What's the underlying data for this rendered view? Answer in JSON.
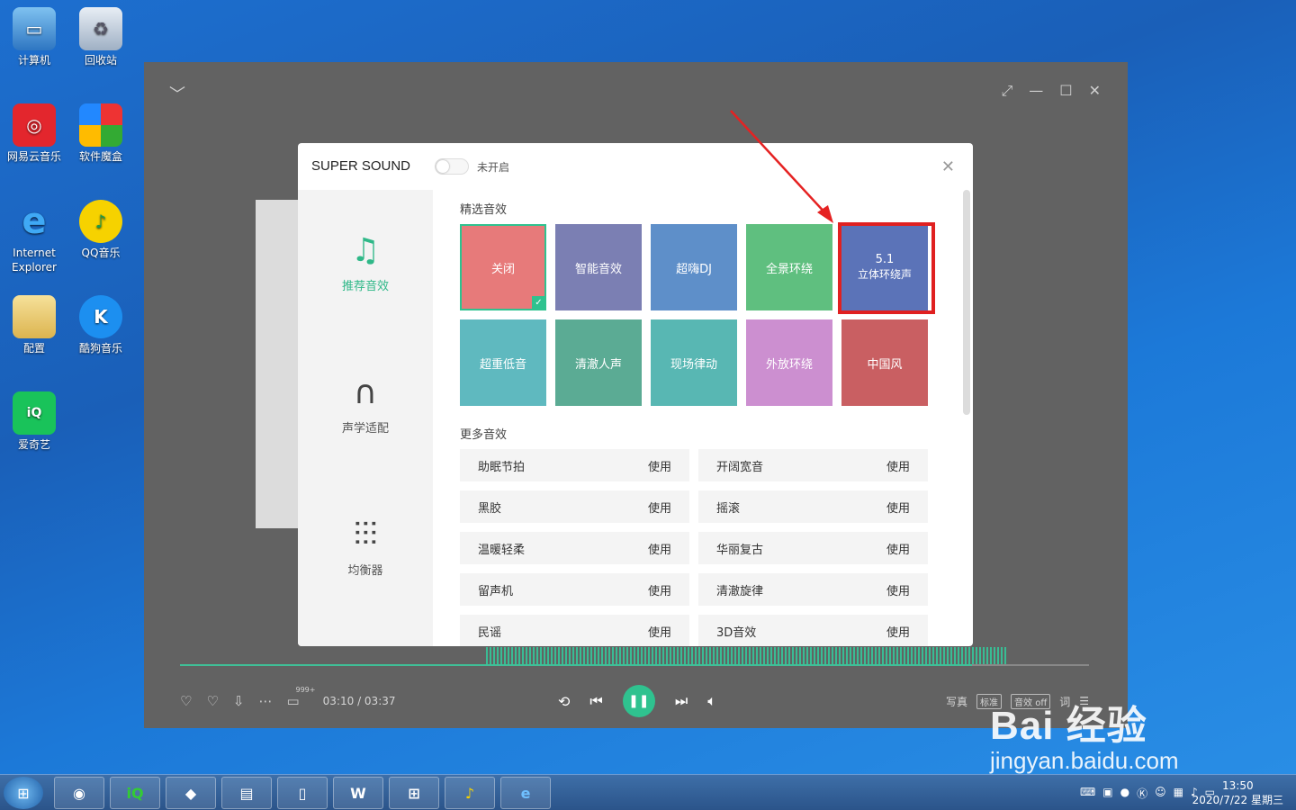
{
  "desktop": {
    "icons": [
      {
        "label": "计算机"
      },
      {
        "label": "回收站"
      },
      {
        "label": "网易云音乐"
      },
      {
        "label": "软件魔盒"
      },
      {
        "label": "Internet Explorer"
      },
      {
        "label": "QQ音乐"
      },
      {
        "label": "配置"
      },
      {
        "label": "酷狗音乐"
      },
      {
        "label": "爱奇艺"
      }
    ]
  },
  "dialog": {
    "title": "SUPER SOUND",
    "toggle_status": "未开启",
    "sidebar": [
      {
        "label": "推荐音效",
        "icon": "music-note-icon"
      },
      {
        "label": "声学适配",
        "icon": "headphone-icon"
      },
      {
        "label": "均衡器",
        "icon": "equalizer-icon"
      }
    ],
    "featured_title": "精选音效",
    "featured": [
      {
        "label": "关闭",
        "color": "#e77a7a",
        "selected": true
      },
      {
        "label": "智能音效",
        "color": "#7b7fb3"
      },
      {
        "label": "超嗨DJ",
        "color": "#5e8fc9"
      },
      {
        "label": "全景环绕",
        "color": "#5fbf7f"
      },
      {
        "label": "5.1",
        "label2": "立体环绕声",
        "color": "#5b73b8"
      },
      {
        "label": "超重低音",
        "color": "#5fb9bf"
      },
      {
        "label": "清澈人声",
        "color": "#5bab94"
      },
      {
        "label": "现场律动",
        "color": "#58b7b3"
      },
      {
        "label": "外放环绕",
        "color": "#cc8fd0"
      },
      {
        "label": "中国风",
        "color": "#c95f62"
      }
    ],
    "more_title": "更多音效",
    "use_label": "使用",
    "more": [
      {
        "label": "助眠节拍"
      },
      {
        "label": "开阔宽音"
      },
      {
        "label": "黑胶"
      },
      {
        "label": "摇滚"
      },
      {
        "label": "温暖轻柔"
      },
      {
        "label": "华丽复古"
      },
      {
        "label": "留声机"
      },
      {
        "label": "清澈旋律"
      },
      {
        "label": "民谣"
      },
      {
        "label": "3D音效"
      }
    ]
  },
  "player": {
    "time": "03:10 / 03:37",
    "comment_count": "999+",
    "right_items": {
      "photo": "写真",
      "quality": "标准",
      "effect": "音效 off",
      "lyrics": "词"
    }
  },
  "taskbar": {
    "clock_time": "13:50",
    "clock_date": "2020/7/22 星期三"
  },
  "watermark": {
    "main": "Bai 经验",
    "sub": "jingyan.baidu.com"
  }
}
